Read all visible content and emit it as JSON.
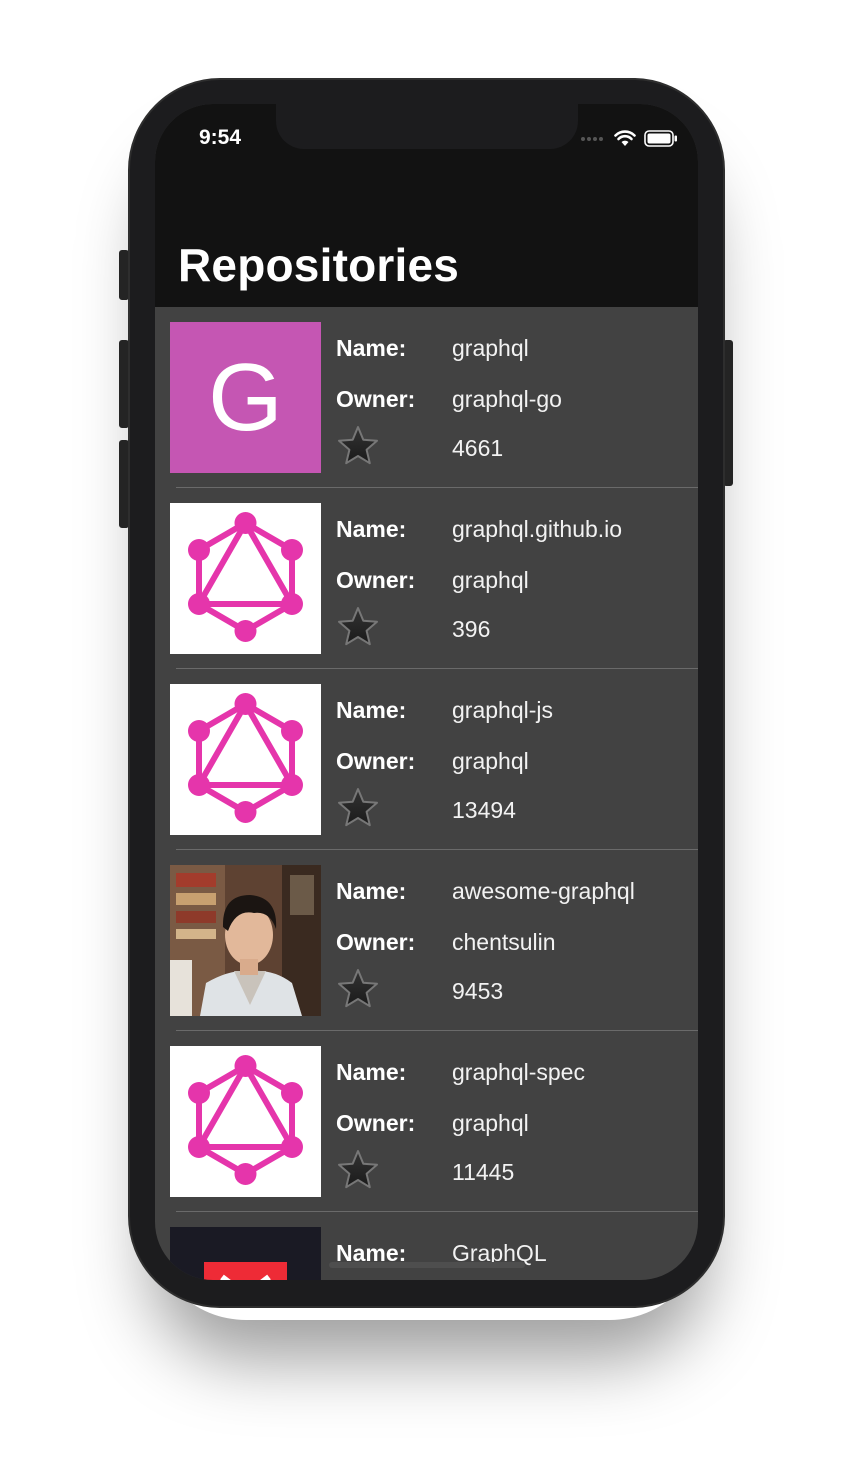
{
  "status_bar": {
    "time": "9:54"
  },
  "nav": {
    "title": "Repositories"
  },
  "labels": {
    "name": "Name:",
    "owner": "Owner:"
  },
  "repos": [
    {
      "name": "graphql",
      "owner": "graphql-go",
      "stars": "4661",
      "avatar": "letter-g",
      "avatar_letter": "G"
    },
    {
      "name": "graphql.github.io",
      "owner": "graphql",
      "stars": "396",
      "avatar": "graphql-logo"
    },
    {
      "name": "graphql-js",
      "owner": "graphql",
      "stars": "13494",
      "avatar": "graphql-logo"
    },
    {
      "name": "awesome-graphql",
      "owner": "chentsulin",
      "stars": "9453",
      "avatar": "user-photo"
    },
    {
      "name": "graphql-spec",
      "owner": "graphql",
      "stars": "11445",
      "avatar": "graphql-logo"
    },
    {
      "name": "GraphQL",
      "avatar": "red-logo"
    }
  ],
  "colors": {
    "header_bg": "#121212",
    "list_bg": "#424242",
    "graphql_pink": "#e535ab",
    "letter_avatar_bg": "#c556b3"
  }
}
